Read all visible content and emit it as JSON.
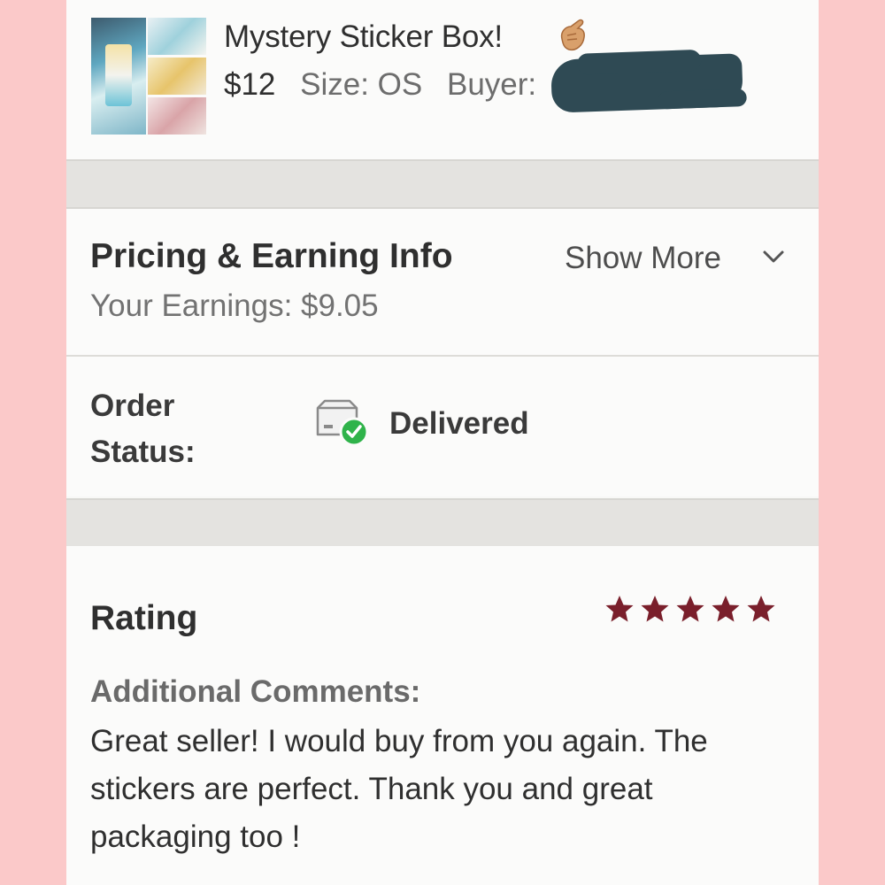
{
  "product": {
    "title": "Mystery Sticker Box!",
    "price": "$12",
    "size_label": "Size: OS",
    "buyer_label": "Buyer:"
  },
  "pricing": {
    "heading": "Pricing & Earning Info",
    "earnings": "Your Earnings: $9.05",
    "show_more": "Show More"
  },
  "order": {
    "label": "Order Status:",
    "status": "Delivered"
  },
  "rating": {
    "heading": "Rating",
    "stars": 5,
    "star_color": "#7a1f2b",
    "comments_heading": "Additional Comments:",
    "comment": "Great seller! I would buy from you again. The stickers are perfect. Thank you and great packaging too !"
  },
  "colors": {
    "background": "#fbc9c9",
    "check_green": "#2fb34a"
  }
}
